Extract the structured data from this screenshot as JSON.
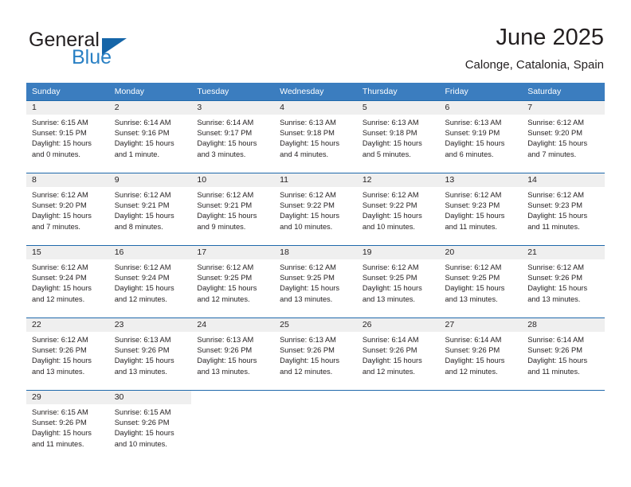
{
  "brand": {
    "name_part1": "General",
    "name_part2": "Blue",
    "triangle_color": "#1565a8",
    "blue_color": "#2980c4"
  },
  "header": {
    "title": "June 2025",
    "location": "Calonge, Catalonia, Spain"
  },
  "theme": {
    "header_bg": "#3b7dbf",
    "row_separator": "#1f69ab",
    "daynum_band_bg": "#efefef",
    "text": "#231f20"
  },
  "weekdays": [
    "Sunday",
    "Monday",
    "Tuesday",
    "Wednesday",
    "Thursday",
    "Friday",
    "Saturday"
  ],
  "weeks": [
    [
      {
        "day": "1",
        "sunrise": "Sunrise: 6:15 AM",
        "sunset": "Sunset: 9:15 PM",
        "daylight1": "Daylight: 15 hours",
        "daylight2": "and 0 minutes."
      },
      {
        "day": "2",
        "sunrise": "Sunrise: 6:14 AM",
        "sunset": "Sunset: 9:16 PM",
        "daylight1": "Daylight: 15 hours",
        "daylight2": "and 1 minute."
      },
      {
        "day": "3",
        "sunrise": "Sunrise: 6:14 AM",
        "sunset": "Sunset: 9:17 PM",
        "daylight1": "Daylight: 15 hours",
        "daylight2": "and 3 minutes."
      },
      {
        "day": "4",
        "sunrise": "Sunrise: 6:13 AM",
        "sunset": "Sunset: 9:18 PM",
        "daylight1": "Daylight: 15 hours",
        "daylight2": "and 4 minutes."
      },
      {
        "day": "5",
        "sunrise": "Sunrise: 6:13 AM",
        "sunset": "Sunset: 9:18 PM",
        "daylight1": "Daylight: 15 hours",
        "daylight2": "and 5 minutes."
      },
      {
        "day": "6",
        "sunrise": "Sunrise: 6:13 AM",
        "sunset": "Sunset: 9:19 PM",
        "daylight1": "Daylight: 15 hours",
        "daylight2": "and 6 minutes."
      },
      {
        "day": "7",
        "sunrise": "Sunrise: 6:12 AM",
        "sunset": "Sunset: 9:20 PM",
        "daylight1": "Daylight: 15 hours",
        "daylight2": "and 7 minutes."
      }
    ],
    [
      {
        "day": "8",
        "sunrise": "Sunrise: 6:12 AM",
        "sunset": "Sunset: 9:20 PM",
        "daylight1": "Daylight: 15 hours",
        "daylight2": "and 7 minutes."
      },
      {
        "day": "9",
        "sunrise": "Sunrise: 6:12 AM",
        "sunset": "Sunset: 9:21 PM",
        "daylight1": "Daylight: 15 hours",
        "daylight2": "and 8 minutes."
      },
      {
        "day": "10",
        "sunrise": "Sunrise: 6:12 AM",
        "sunset": "Sunset: 9:21 PM",
        "daylight1": "Daylight: 15 hours",
        "daylight2": "and 9 minutes."
      },
      {
        "day": "11",
        "sunrise": "Sunrise: 6:12 AM",
        "sunset": "Sunset: 9:22 PM",
        "daylight1": "Daylight: 15 hours",
        "daylight2": "and 10 minutes."
      },
      {
        "day": "12",
        "sunrise": "Sunrise: 6:12 AM",
        "sunset": "Sunset: 9:22 PM",
        "daylight1": "Daylight: 15 hours",
        "daylight2": "and 10 minutes."
      },
      {
        "day": "13",
        "sunrise": "Sunrise: 6:12 AM",
        "sunset": "Sunset: 9:23 PM",
        "daylight1": "Daylight: 15 hours",
        "daylight2": "and 11 minutes."
      },
      {
        "day": "14",
        "sunrise": "Sunrise: 6:12 AM",
        "sunset": "Sunset: 9:23 PM",
        "daylight1": "Daylight: 15 hours",
        "daylight2": "and 11 minutes."
      }
    ],
    [
      {
        "day": "15",
        "sunrise": "Sunrise: 6:12 AM",
        "sunset": "Sunset: 9:24 PM",
        "daylight1": "Daylight: 15 hours",
        "daylight2": "and 12 minutes."
      },
      {
        "day": "16",
        "sunrise": "Sunrise: 6:12 AM",
        "sunset": "Sunset: 9:24 PM",
        "daylight1": "Daylight: 15 hours",
        "daylight2": "and 12 minutes."
      },
      {
        "day": "17",
        "sunrise": "Sunrise: 6:12 AM",
        "sunset": "Sunset: 9:25 PM",
        "daylight1": "Daylight: 15 hours",
        "daylight2": "and 12 minutes."
      },
      {
        "day": "18",
        "sunrise": "Sunrise: 6:12 AM",
        "sunset": "Sunset: 9:25 PM",
        "daylight1": "Daylight: 15 hours",
        "daylight2": "and 13 minutes."
      },
      {
        "day": "19",
        "sunrise": "Sunrise: 6:12 AM",
        "sunset": "Sunset: 9:25 PM",
        "daylight1": "Daylight: 15 hours",
        "daylight2": "and 13 minutes."
      },
      {
        "day": "20",
        "sunrise": "Sunrise: 6:12 AM",
        "sunset": "Sunset: 9:25 PM",
        "daylight1": "Daylight: 15 hours",
        "daylight2": "and 13 minutes."
      },
      {
        "day": "21",
        "sunrise": "Sunrise: 6:12 AM",
        "sunset": "Sunset: 9:26 PM",
        "daylight1": "Daylight: 15 hours",
        "daylight2": "and 13 minutes."
      }
    ],
    [
      {
        "day": "22",
        "sunrise": "Sunrise: 6:12 AM",
        "sunset": "Sunset: 9:26 PM",
        "daylight1": "Daylight: 15 hours",
        "daylight2": "and 13 minutes."
      },
      {
        "day": "23",
        "sunrise": "Sunrise: 6:13 AM",
        "sunset": "Sunset: 9:26 PM",
        "daylight1": "Daylight: 15 hours",
        "daylight2": "and 13 minutes."
      },
      {
        "day": "24",
        "sunrise": "Sunrise: 6:13 AM",
        "sunset": "Sunset: 9:26 PM",
        "daylight1": "Daylight: 15 hours",
        "daylight2": "and 13 minutes."
      },
      {
        "day": "25",
        "sunrise": "Sunrise: 6:13 AM",
        "sunset": "Sunset: 9:26 PM",
        "daylight1": "Daylight: 15 hours",
        "daylight2": "and 12 minutes."
      },
      {
        "day": "26",
        "sunrise": "Sunrise: 6:14 AM",
        "sunset": "Sunset: 9:26 PM",
        "daylight1": "Daylight: 15 hours",
        "daylight2": "and 12 minutes."
      },
      {
        "day": "27",
        "sunrise": "Sunrise: 6:14 AM",
        "sunset": "Sunset: 9:26 PM",
        "daylight1": "Daylight: 15 hours",
        "daylight2": "and 12 minutes."
      },
      {
        "day": "28",
        "sunrise": "Sunrise: 6:14 AM",
        "sunset": "Sunset: 9:26 PM",
        "daylight1": "Daylight: 15 hours",
        "daylight2": "and 11 minutes."
      }
    ],
    [
      {
        "day": "29",
        "sunrise": "Sunrise: 6:15 AM",
        "sunset": "Sunset: 9:26 PM",
        "daylight1": "Daylight: 15 hours",
        "daylight2": "and 11 minutes."
      },
      {
        "day": "30",
        "sunrise": "Sunrise: 6:15 AM",
        "sunset": "Sunset: 9:26 PM",
        "daylight1": "Daylight: 15 hours",
        "daylight2": "and 10 minutes."
      },
      {
        "day": "",
        "sunrise": "",
        "sunset": "",
        "daylight1": "",
        "daylight2": ""
      },
      {
        "day": "",
        "sunrise": "",
        "sunset": "",
        "daylight1": "",
        "daylight2": ""
      },
      {
        "day": "",
        "sunrise": "",
        "sunset": "",
        "daylight1": "",
        "daylight2": ""
      },
      {
        "day": "",
        "sunrise": "",
        "sunset": "",
        "daylight1": "",
        "daylight2": ""
      },
      {
        "day": "",
        "sunrise": "",
        "sunset": "",
        "daylight1": "",
        "daylight2": ""
      }
    ]
  ]
}
